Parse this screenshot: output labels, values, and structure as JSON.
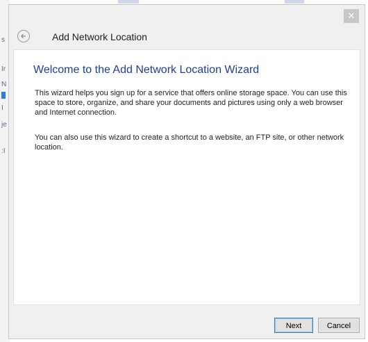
{
  "window": {
    "title": "Add Network Location",
    "close_glyph": "✕",
    "back_icon": "back-arrow-icon"
  },
  "wizard": {
    "heading": "Welcome to the Add Network Location Wizard",
    "paragraph_1": "This wizard helps you sign up for a service that offers online storage space.  You can use this space to store, organize, and share your documents and pictures using only a web browser and Internet connection.",
    "paragraph_2": "You can also use this wizard to create a shortcut to a website, an FTP site, or other network location."
  },
  "footer": {
    "next_label": "Next",
    "cancel_label": "Cancel"
  },
  "colors": {
    "heading": "#1c3f94",
    "accent_border": "#3c7fb1"
  }
}
